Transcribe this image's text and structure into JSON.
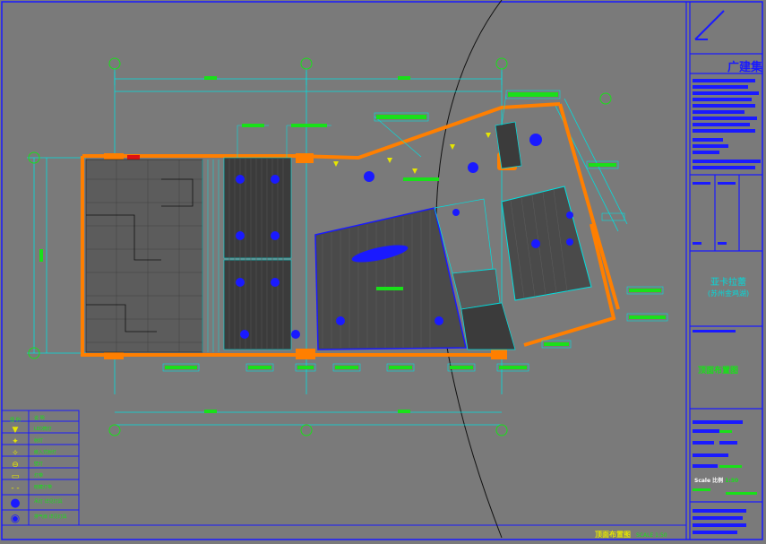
{
  "title_block": {
    "brand": "广建集",
    "project_line1": "亚卡拉蕾",
    "project_line2": "(苏州金鸡湖)",
    "drawing_name": "顶面布置图",
    "scale_label": "Scale 比例",
    "scale_value": "1:50"
  },
  "plan_title": {
    "name": "顶面布置图",
    "scale": "SCALE 1:50"
  },
  "grid_bubbles": [
    "1",
    "2",
    "3",
    "A",
    "B",
    "C",
    "D"
  ],
  "legend": {
    "header_symbol": "图 例",
    "header_desc": "说 明",
    "items": [
      {
        "symbol": "▼",
        "icon": "downlight-icon",
        "desc": "LED筒灯"
      },
      {
        "symbol": "✦",
        "icon": "spotlight-icon",
        "desc": "射灯"
      },
      {
        "symbol": "✧",
        "icon": "recessed-light-icon",
        "desc": "嵌入式射灯"
      },
      {
        "symbol": "⊖",
        "icon": "wall-light-icon",
        "desc": "壁灯"
      },
      {
        "symbol": "▭",
        "icon": "strip-light-icon",
        "desc": "灯带"
      },
      {
        "symbol": "- -",
        "icon": "hidden-strip-icon",
        "desc": "暗藏灯带"
      },
      {
        "symbol": "●",
        "icon": "pendant-icon",
        "desc": "吊灯 详见灯具"
      },
      {
        "symbol": "◉",
        "icon": "ceiling-fan-icon",
        "desc": "排气扇 详见灯具"
      },
      {
        "symbol": "▬",
        "icon": "linear-pendant-icon",
        "desc": "线型吊灯 详见灯具"
      }
    ]
  },
  "colors": {
    "background": "#7a7a7a",
    "frame_blue": "#1a1aff",
    "dimension_cyan": "#00e0e0",
    "label_green": "#19e019",
    "wall_orange": "#ff7f00",
    "hatch_dark": "#333333",
    "symbol_yellow": "#e6e600"
  }
}
